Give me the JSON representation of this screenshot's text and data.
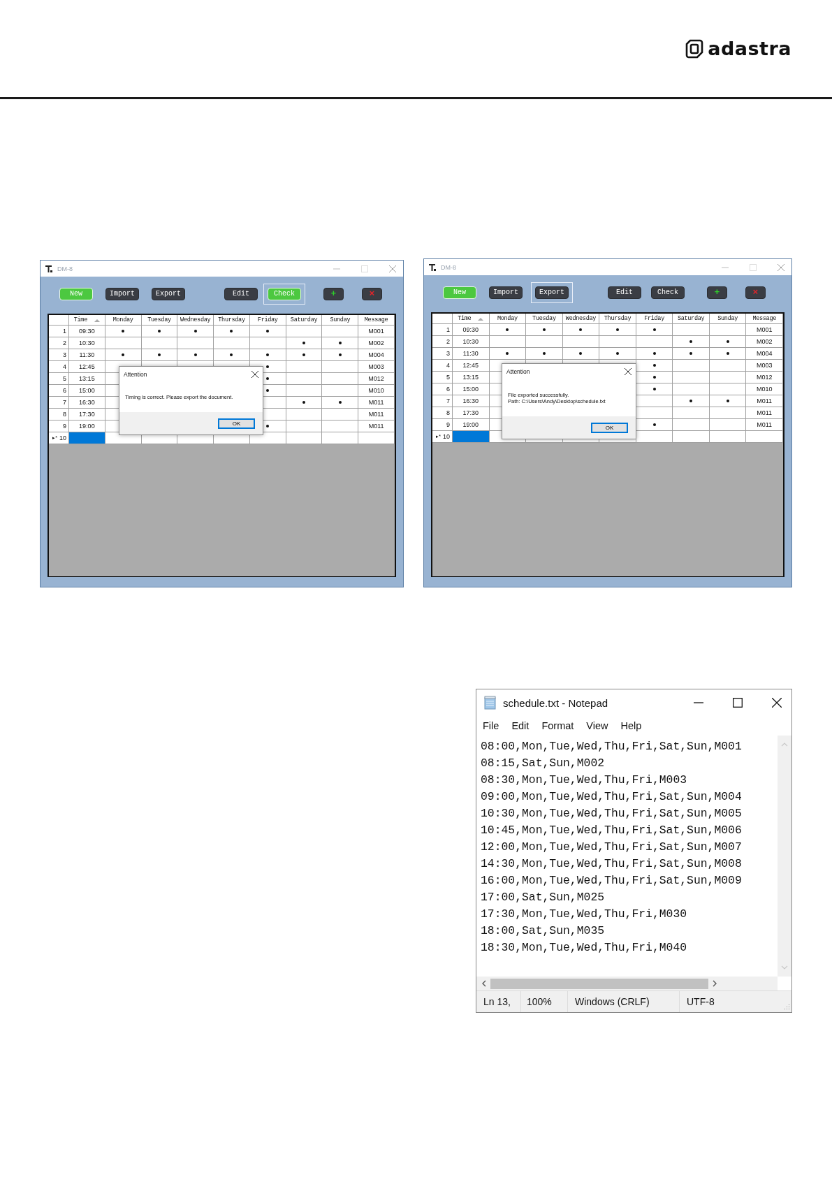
{
  "header": {
    "logo": "adastra"
  },
  "windows": [
    {
      "title": "DM-8",
      "toolbar_groups": [
        {
          "buttons": [
            {
              "label": "New",
              "kind": "text",
              "highlighted": true,
              "focused": false
            },
            {
              "label": "Import",
              "kind": "text",
              "highlighted": false,
              "focused": false
            },
            {
              "label": "Export",
              "kind": "text",
              "highlighted": false,
              "focused": false
            }
          ]
        },
        {
          "buttons": [
            {
              "label": "Edit",
              "kind": "text",
              "highlighted": false,
              "focused": false
            },
            {
              "label": "Check",
              "kind": "text",
              "highlighted": true,
              "focused": true
            }
          ]
        },
        {
          "buttons": [
            {
              "label": "+",
              "kind": "add",
              "highlighted": false,
              "focused": false
            },
            {
              "label": "×",
              "kind": "remove",
              "highlighted": false,
              "focused": false
            }
          ]
        }
      ],
      "table": {
        "columns": [
          {
            "label": "Time",
            "sorted_ascending": true
          },
          {
            "label": "Monday",
            "sorted_ascending": false
          },
          {
            "label": "Tuesday",
            "sorted_ascending": false
          },
          {
            "label": "Wednesday",
            "sorted_ascending": false
          },
          {
            "label": "Thursday",
            "sorted_ascending": false
          },
          {
            "label": "Friday",
            "sorted_ascending": false
          },
          {
            "label": "Saturday",
            "sorted_ascending": false
          },
          {
            "label": "Sunday",
            "sorted_ascending": false
          },
          {
            "label": "Message",
            "sorted_ascending": false
          }
        ],
        "rows": [
          {
            "number": "1",
            "time": "09:30",
            "days": {
              "mon": true,
              "tue": true,
              "wed": true,
              "thu": true,
              "fri": true,
              "sat": false,
              "sun": false
            },
            "message": "M001",
            "selected": false
          },
          {
            "number": "2",
            "time": "10:30",
            "days": {
              "mon": false,
              "tue": false,
              "wed": false,
              "thu": false,
              "fri": false,
              "sat": true,
              "sun": true
            },
            "message": "M002",
            "selected": false
          },
          {
            "number": "3",
            "time": "11:30",
            "days": {
              "mon": true,
              "tue": true,
              "wed": true,
              "thu": true,
              "fri": true,
              "sat": true,
              "sun": true
            },
            "message": "M004",
            "selected": false
          },
          {
            "number": "4",
            "time": "12:45",
            "days": {
              "fri": true,
              "sat": false,
              "sun": false
            },
            "message": "M003",
            "selected": false
          },
          {
            "number": "5",
            "time": "13:15",
            "days": {
              "fri": true,
              "sat": false,
              "sun": false
            },
            "message": "M012",
            "selected": false
          },
          {
            "number": "6",
            "time": "15:00",
            "days": {
              "fri": true,
              "sat": false,
              "sun": false
            },
            "message": "M010",
            "selected": false
          },
          {
            "number": "7",
            "time": "16:30",
            "days": {
              "fri": false,
              "sat": true,
              "sun": true
            },
            "message": "M011",
            "selected": false
          },
          {
            "number": "8",
            "time": "17:30",
            "days": {
              "fri": false,
              "sat": false,
              "sun": false
            },
            "message": "M011",
            "selected": false
          },
          {
            "number": "9",
            "time": "19:00",
            "days": {
              "fri": true,
              "sat": false,
              "sun": false
            },
            "message": "M011",
            "selected": false
          },
          {
            "number": "10",
            "marker": "▸*",
            "days": {
              "mon": false,
              "tue": false,
              "wed": false,
              "thu": false,
              "fri": false,
              "sat": false,
              "sun": false
            },
            "selected": true
          }
        ]
      },
      "dialog": {
        "title": "Attention",
        "message_lines": [
          "Timing is correct. Please export the document."
        ],
        "button": "OK"
      }
    },
    {
      "title": "DM-8",
      "toolbar_groups": [
        {
          "buttons": [
            {
              "label": "New",
              "kind": "text",
              "highlighted": true,
              "focused": false
            },
            {
              "label": "Import",
              "kind": "text",
              "highlighted": false,
              "focused": false
            },
            {
              "label": "Export",
              "kind": "text",
              "highlighted": false,
              "focused": true
            }
          ]
        },
        {
          "buttons": [
            {
              "label": "Edit",
              "kind": "text",
              "highlighted": false,
              "focused": false
            },
            {
              "label": "Check",
              "kind": "text",
              "highlighted": false,
              "focused": false
            }
          ]
        },
        {
          "buttons": [
            {
              "label": "+",
              "kind": "add",
              "highlighted": false,
              "focused": false
            },
            {
              "label": "×",
              "kind": "remove",
              "highlighted": false,
              "focused": false
            }
          ]
        }
      ],
      "table": {
        "columns": [
          {
            "label": "Time",
            "sorted_ascending": true
          },
          {
            "label": "Monday",
            "sorted_ascending": false
          },
          {
            "label": "Tuesday",
            "sorted_ascending": false
          },
          {
            "label": "Wednesday",
            "sorted_ascending": false
          },
          {
            "label": "Thursday",
            "sorted_ascending": false
          },
          {
            "label": "Friday",
            "sorted_ascending": false
          },
          {
            "label": "Saturday",
            "sorted_ascending": false
          },
          {
            "label": "Sunday",
            "sorted_ascending": false
          },
          {
            "label": "Message",
            "sorted_ascending": false
          }
        ],
        "rows": [
          {
            "number": "1",
            "time": "09:30",
            "days": {
              "mon": true,
              "tue": true,
              "wed": true,
              "thu": true,
              "fri": true,
              "sat": false,
              "sun": false
            },
            "message": "M001",
            "selected": false
          },
          {
            "number": "2",
            "time": "10:30",
            "days": {
              "mon": false,
              "tue": false,
              "wed": false,
              "thu": false,
              "fri": false,
              "sat": true,
              "sun": true
            },
            "message": "M002",
            "selected": false
          },
          {
            "number": "3",
            "time": "11:30",
            "days": {
              "mon": true,
              "tue": true,
              "wed": true,
              "thu": true,
              "fri": true,
              "sat": true,
              "sun": true
            },
            "message": "M004",
            "selected": false
          },
          {
            "number": "4",
            "time": "12:45",
            "days": {
              "fri": true,
              "sat": false,
              "sun": false
            },
            "message": "M003",
            "selected": false
          },
          {
            "number": "5",
            "time": "13:15",
            "days": {
              "fri": true,
              "sat": false,
              "sun": false
            },
            "message": "M012",
            "selected": false
          },
          {
            "number": "6",
            "time": "15:00",
            "days": {
              "fri": true,
              "sat": false,
              "sun": false
            },
            "message": "M010",
            "selected": false
          },
          {
            "number": "7",
            "time": "16:30",
            "days": {
              "fri": false,
              "sat": true,
              "sun": true
            },
            "message": "M011",
            "selected": false
          },
          {
            "number": "8",
            "time": "17:30",
            "days": {
              "fri": false,
              "sat": false,
              "sun": false
            },
            "message": "M011",
            "selected": false
          },
          {
            "number": "9",
            "time": "19:00",
            "days": {
              "fri": true,
              "sat": false,
              "sun": false
            },
            "message": "M011",
            "selected": false
          },
          {
            "number": "10",
            "marker": "▸*",
            "days": {
              "fri": false,
              "sat": false,
              "sun": false
            },
            "selected": true
          }
        ]
      },
      "dialog": {
        "title": "Attention",
        "message_lines": [
          "File exported successfully.",
          "Path: C:\\Users\\Andy\\Desktop\\schedule.txt"
        ],
        "button": "OK"
      }
    }
  ],
  "notepad": {
    "title": "schedule.txt - Notepad",
    "menu": [
      "File",
      "Edit",
      "Format",
      "View",
      "Help"
    ],
    "lines": [
      "08:00,Mon,Tue,Wed,Thu,Fri,Sat,Sun,M001",
      "08:15,Sat,Sun,M002",
      "08:30,Mon,Tue,Wed,Thu,Fri,M003",
      "09:00,Mon,Tue,Wed,Thu,Fri,Sat,Sun,M004",
      "10:30,Mon,Tue,Wed,Thu,Fri,Sat,Sun,M005",
      "10:45,Mon,Tue,Wed,Thu,Fri,Sat,Sun,M006",
      "12:00,Mon,Tue,Wed,Thu,Fri,Sat,Sun,M007",
      "14:30,Mon,Tue,Wed,Thu,Fri,Sat,Sun,M008",
      "16:00,Mon,Tue,Wed,Thu,Fri,Sat,Sun,M009",
      "17:00,Sat,Sun,M025",
      "17:30,Mon,Tue,Wed,Thu,Fri,M030",
      "18:00,Sat,Sun,M035",
      "18:30,Mon,Tue,Wed,Thu,Fri,M040"
    ],
    "status": [
      "Ln 13,",
      "100%",
      "Windows (CRLF)",
      "UTF-8"
    ]
  }
}
